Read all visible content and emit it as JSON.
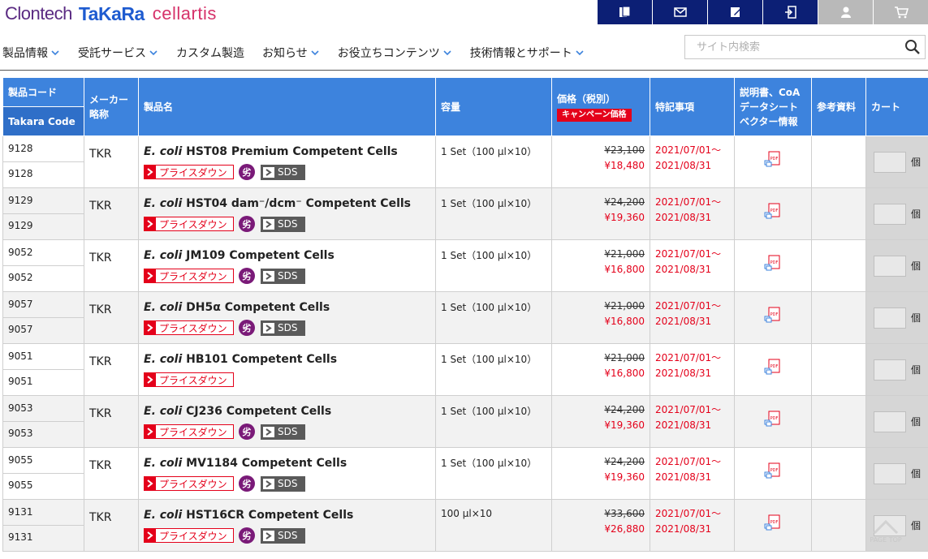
{
  "logos": {
    "clontech": "Clontech",
    "takara": "TaKaRa",
    "cellartis": "cellartis"
  },
  "util_icons": [
    "copy-icon",
    "mail-icon",
    "edit-icon",
    "login-icon",
    "user-icon",
    "cart-icon"
  ],
  "nav": [
    {
      "label": "製品情報",
      "dropdown": true
    },
    {
      "label": "受託サービス",
      "dropdown": true
    },
    {
      "label": "カスタム製造",
      "dropdown": false
    },
    {
      "label": "お知らせ",
      "dropdown": true
    },
    {
      "label": "お役立ちコンテンツ",
      "dropdown": true
    },
    {
      "label": "技術情報とサポート",
      "dropdown": true
    }
  ],
  "search": {
    "placeholder": "サイト内検索"
  },
  "table": {
    "headers": {
      "code": "製品コード",
      "takara_code": "Takara Code",
      "maker": "メーカー略称",
      "name": "製品名",
      "capacity": "容量",
      "price": "価格（税別）",
      "campaign": "キャンペーン価格",
      "notes": "特記事項",
      "docs": "説明書、CoAデータシートベクター情報",
      "refs": "参考資料",
      "cart": "カート"
    },
    "badge_labels": {
      "price_down": "プライスダウン",
      "circle": "劣",
      "sds": "SDS"
    },
    "unit": "個",
    "rows": [
      {
        "code": "9128",
        "takara_code": "9128",
        "maker": "TKR",
        "name_pre": "HST08 Premium Competent Cells",
        "name_ital": "E. coli",
        "capacity": "1 Set（100 µl×10）",
        "price_orig": "¥23,100",
        "price_sale": "¥18,480",
        "note1": "2021/07/01～",
        "note2": "2021/08/31",
        "circle": true,
        "sds": true
      },
      {
        "code": "9129",
        "takara_code": "9129",
        "maker": "TKR",
        "name_pre": "HST04 dam⁻/dcm⁻ Competent Cells",
        "name_ital": "E. coli",
        "capacity": "1 Set（100 µl×10）",
        "price_orig": "¥24,200",
        "price_sale": "¥19,360",
        "note1": "2021/07/01～",
        "note2": "2021/08/31",
        "circle": true,
        "sds": true
      },
      {
        "code": "9052",
        "takara_code": "9052",
        "maker": "TKR",
        "name_pre": "JM109 Competent Cells",
        "name_ital": "E. coli",
        "capacity": "1 Set（100 µl×10）",
        "price_orig": "¥21,000",
        "price_sale": "¥16,800",
        "note1": "2021/07/01～",
        "note2": "2021/08/31",
        "circle": true,
        "sds": true
      },
      {
        "code": "9057",
        "takara_code": "9057",
        "maker": "TKR",
        "name_pre": "DH5α Competent Cells",
        "name_ital": "E. coli",
        "capacity": "1 Set（100 µl×10）",
        "price_orig": "¥21,000",
        "price_sale": "¥16,800",
        "note1": "2021/07/01～",
        "note2": "2021/08/31",
        "circle": true,
        "sds": true
      },
      {
        "code": "9051",
        "takara_code": "9051",
        "maker": "TKR",
        "name_pre": "HB101 Competent Cells",
        "name_ital": "E. coli",
        "capacity": "1 Set（100 µl×10）",
        "price_orig": "¥21,000",
        "price_sale": "¥16,800",
        "note1": "2021/07/01～",
        "note2": "2021/08/31",
        "circle": false,
        "sds": false
      },
      {
        "code": "9053",
        "takara_code": "9053",
        "maker": "TKR",
        "name_pre": "CJ236 Competent Cells",
        "name_ital": "E. coli",
        "capacity": "1 Set（100 µl×10）",
        "price_orig": "¥24,200",
        "price_sale": "¥19,360",
        "note1": "2021/07/01～",
        "note2": "2021/08/31",
        "circle": true,
        "sds": true
      },
      {
        "code": "9055",
        "takara_code": "9055",
        "maker": "TKR",
        "name_pre": "MV1184 Competent Cells",
        "name_ital": "E. coli",
        "capacity": "1 Set（100 µl×10）",
        "price_orig": "¥24,200",
        "price_sale": "¥19,360",
        "note1": "2021/07/01～",
        "note2": "2021/08/31",
        "circle": true,
        "sds": true
      },
      {
        "code": "9131",
        "takara_code": "9131",
        "maker": "TKR",
        "name_pre": "HST16CR Competent Cells",
        "name_ital": "E. coli",
        "capacity": "100 µl×10",
        "price_orig": "¥33,600",
        "price_sale": "¥26,880",
        "note1": "2021/07/01～",
        "note2": "2021/08/31",
        "circle": true,
        "sds": true
      }
    ]
  },
  "page_top": {
    "label": "PAGE TOP"
  },
  "colors": {
    "header_blue": "#3d83dd",
    "util_navy": "#0c1f75",
    "accent_red": "#e4001a",
    "circle_purple": "#7a1a78"
  }
}
